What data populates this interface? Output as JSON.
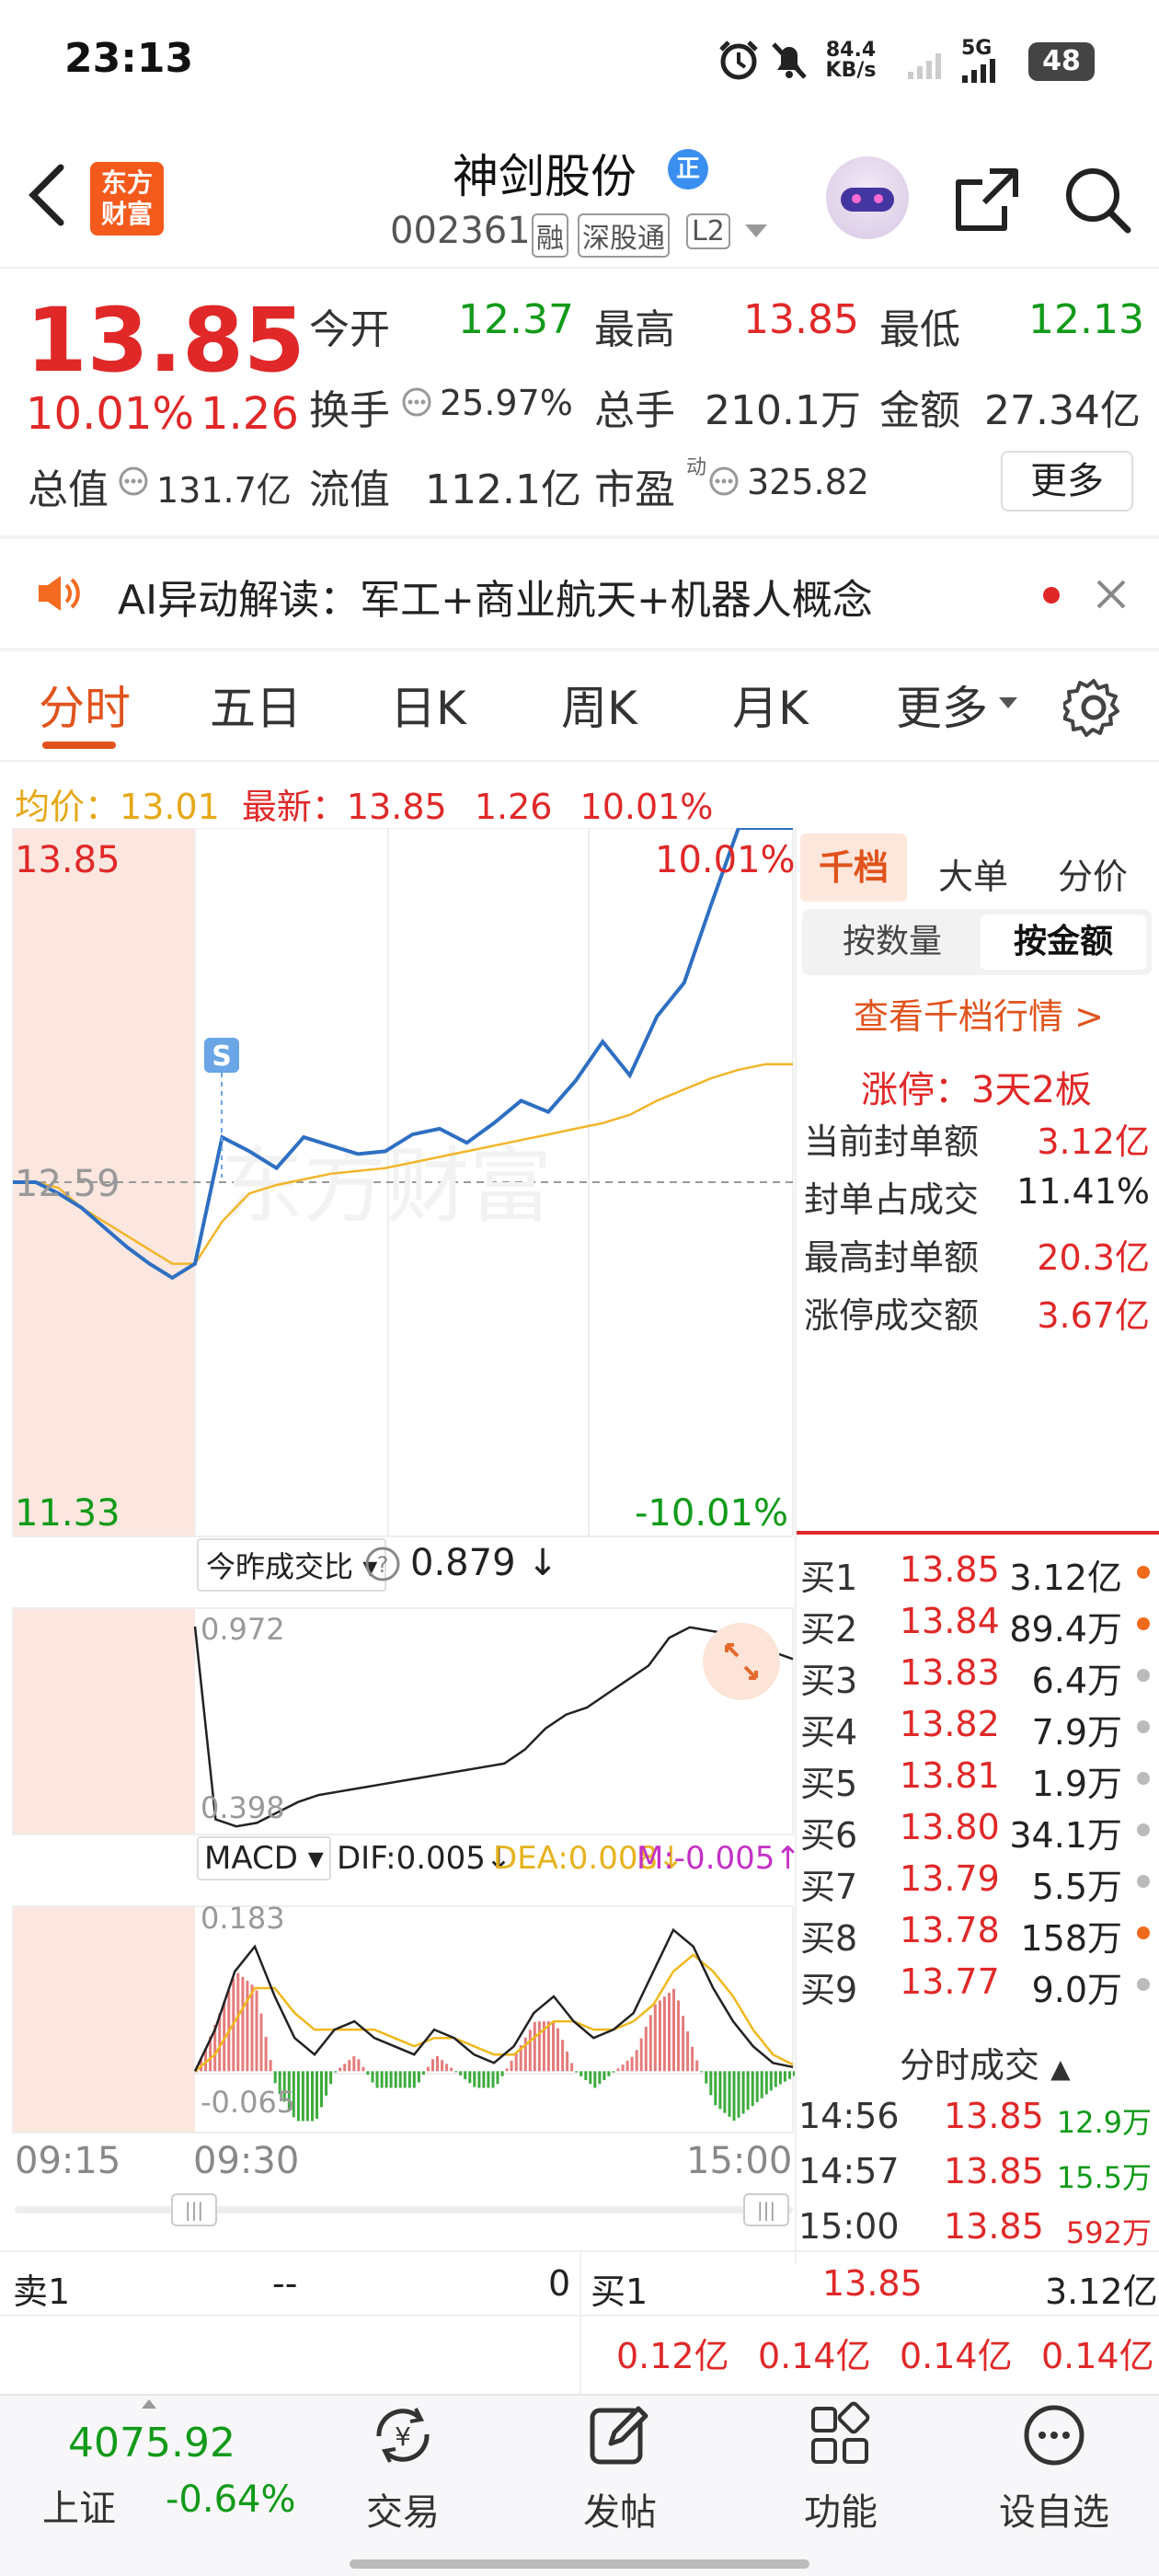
{
  "status": {
    "time": "23:13",
    "net_speed": "84.4",
    "net_unit": "KB/s",
    "network": "5G",
    "battery": "48"
  },
  "header": {
    "logo_line1": "东方",
    "logo_line2": "财富",
    "stock_name": "神剑股份",
    "name_badge": "正",
    "code": "002361",
    "tag_rong": "融",
    "tag_sgt": "深股通",
    "tag_l2": "L2"
  },
  "quote": {
    "price": "13.85",
    "change_pct": "10.01%",
    "change": "1.26",
    "open_label": "今开",
    "open": "12.37",
    "high_label": "最高",
    "high": "13.85",
    "low_label": "最低",
    "low": "12.13",
    "turnover_label": "换手",
    "turnover": "25.97%",
    "volume_label": "总手",
    "volume": "210.1万",
    "amount_label": "金额",
    "amount": "27.34亿",
    "mcap_label": "总值",
    "mcap": "131.7亿",
    "float_label": "流值",
    "float": "112.1亿",
    "pe_label": "市盈",
    "pe_sup": "动",
    "pe": "325.82",
    "more_btn": "更多"
  },
  "ai_banner": {
    "text": "AI异动解读：军工+商业航天+机器人概念"
  },
  "tabs": [
    "分时",
    "五日",
    "日K",
    "周K",
    "月K",
    "更多"
  ],
  "chart_info": {
    "avg_label": "均价：",
    "avg": "13.01",
    "latest_label": "最新：",
    "latest": "13.85",
    "chg": "1.26",
    "pct": "10.01%"
  },
  "chart": {
    "y_top": "13.85",
    "y_mid": "12.59",
    "y_bot": "11.33",
    "pct_top": "10.01%",
    "pct_bot": "-10.01%",
    "s_marker": "S",
    "watermark": "东方财富",
    "ratio_label": "今昨成交比",
    "ratio_val": "0.879 ↓",
    "ratio_top": "0.972",
    "ratio_bot": "0.398",
    "macd_label": "MACD",
    "dif": "DIF:0.005↓",
    "dea": "DEA:0.008↓",
    "m": "M:-0.005↑",
    "macd_top": "0.183",
    "macd_bot": "-0.065",
    "t_915": "09:15",
    "t_930": "09:30",
    "t_1500": "15:00"
  },
  "chart_data": {
    "type": "line",
    "x_range": [
      "09:15",
      "15:00"
    ],
    "price_range": [
      11.33,
      13.85
    ],
    "prev_close": 12.59,
    "series": [
      {
        "values": [
          12.59,
          12.59,
          12.55,
          12.5,
          12.43,
          12.36,
          12.3,
          12.25,
          12.3,
          12.75,
          12.7,
          12.64,
          12.75,
          12.72,
          12.69,
          12.7,
          12.76,
          12.78,
          12.73,
          12.8,
          12.88,
          12.84,
          12.95,
          13.09,
          12.97,
          13.18,
          13.3,
          13.58,
          13.85,
          13.85,
          13.85
        ]
      },
      {
        "values": [
          12.59,
          12.59,
          12.57,
          12.5,
          12.45,
          12.4,
          12.35,
          12.3,
          12.3,
          12.45,
          12.55,
          12.58,
          12.6,
          12.62,
          12.63,
          12.64,
          12.66,
          12.68,
          12.7,
          12.72,
          12.74,
          12.76,
          12.78,
          12.8,
          12.83,
          12.88,
          12.92,
          12.96,
          12.99,
          13.01,
          13.01
        ]
      }
    ]
  },
  "right_panel": {
    "tab_qd": "千档",
    "tab_dd": "大单",
    "tab_fj": "分价",
    "sub_qty": "按数量",
    "sub_amt": "按金额",
    "view_link": "查看千档行情 >",
    "limit_up": "涨停：3天2板",
    "rows": [
      {
        "label": "当前封单额",
        "value": "3.12亿"
      },
      {
        "label": "封单占成交",
        "value": "11.41%"
      },
      {
        "label": "最高封单额",
        "value": "20.3亿"
      },
      {
        "label": "涨停成交额",
        "value": "3.67亿"
      }
    ]
  },
  "orderbook": [
    {
      "label": "买1",
      "price": "13.85",
      "vol": "3.12亿"
    },
    {
      "label": "买2",
      "price": "13.84",
      "vol": "89.4万"
    },
    {
      "label": "买3",
      "price": "13.83",
      "vol": "6.4万"
    },
    {
      "label": "买4",
      "price": "13.82",
      "vol": "7.9万"
    },
    {
      "label": "买5",
      "price": "13.81",
      "vol": "1.9万"
    },
    {
      "label": "买6",
      "price": "13.80",
      "vol": "34.1万"
    },
    {
      "label": "买7",
      "price": "13.79",
      "vol": "5.5万"
    },
    {
      "label": "买8",
      "price": "13.78",
      "vol": "158万"
    },
    {
      "label": "买9",
      "price": "13.77",
      "vol": "9.0万"
    }
  ],
  "trades": {
    "title": "分时成交",
    "rows": [
      {
        "time": "14:56",
        "price": "13.85",
        "vol": "12.9万"
      },
      {
        "time": "14:57",
        "price": "13.85",
        "vol": "15.5万"
      },
      {
        "time": "15:00",
        "price": "13.85",
        "vol": "592万"
      }
    ]
  },
  "bottom_quote": {
    "sell1_label": "卖1",
    "sell1_price": "--",
    "sell1_vol": "0",
    "buy1_label": "买1",
    "buy1_price": "13.85",
    "buy1_vol": "3.12亿",
    "queue": [
      "0.12亿",
      "0.14亿",
      "0.14亿",
      "0.14亿"
    ]
  },
  "nav": {
    "index_val": "4075.92",
    "index_name": "上证",
    "index_chg": "-0.64%",
    "items": [
      "交易",
      "发帖",
      "功能",
      "设自选"
    ]
  }
}
